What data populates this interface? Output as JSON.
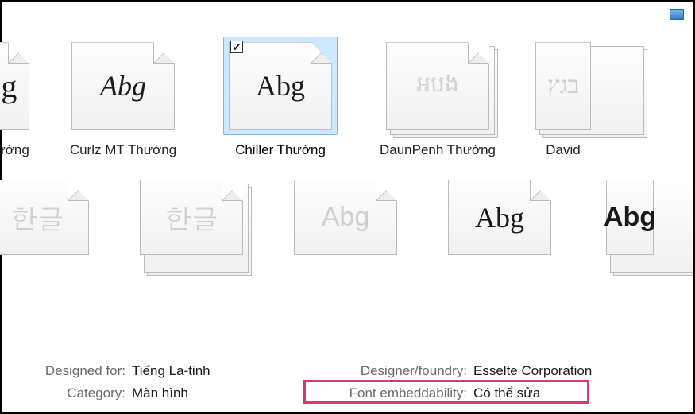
{
  "toolbar": {
    "preview_icon": "image-icon"
  },
  "row1": [
    {
      "sample": "Abg",
      "label": "urier Thường",
      "style": "serif",
      "partial": true,
      "faded": false,
      "stack": false
    },
    {
      "sample": "Abg",
      "label": "Curlz MT Thường",
      "style": "curlz",
      "faded": false,
      "stack": false
    },
    {
      "sample": "Abg",
      "label": "Chiller Thường",
      "style": "chiller",
      "selected": true,
      "faded": false,
      "stack": false
    },
    {
      "sample": "អបង",
      "label": "DaunPenh Thường",
      "style": "",
      "faded": true,
      "stack": true
    },
    {
      "sample": "בגץ",
      "label": "David",
      "style": "serif",
      "partial_right": true,
      "faded": true,
      "stack": true
    }
  ],
  "row2": [
    {
      "sample": "한글",
      "style": "square",
      "faded": true,
      "stack": false
    },
    {
      "sample": "한글",
      "style": "square",
      "faded": true,
      "stack": true
    },
    {
      "sample": "Abg",
      "style": "",
      "faded": true,
      "stack": false
    },
    {
      "sample": "Abg",
      "style": "cursive",
      "faded": false,
      "stack": false
    },
    {
      "sample": "Abg",
      "style": "bold",
      "faded": false,
      "stack": true,
      "partial_right": true
    }
  ],
  "details": {
    "designed_for_label": "Designed for:",
    "designed_for_value": "Tiếng La-tinh",
    "category_label": "Category:",
    "category_value": "Màn hình",
    "designer_label": "Designer/foundry:",
    "designer_value": "Esselte Corporation",
    "embed_label": "Font embeddability:",
    "embed_value": "Có thể sửa"
  }
}
